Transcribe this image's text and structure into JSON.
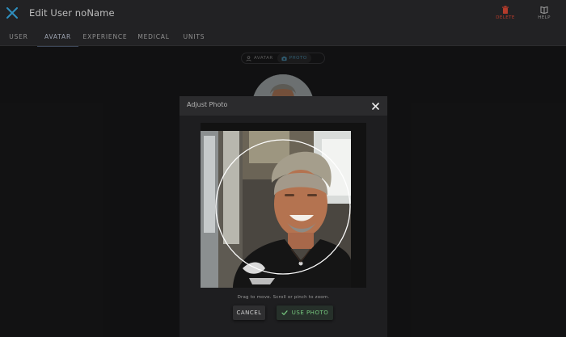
{
  "header": {
    "title": "Edit User noName",
    "actions": [
      {
        "label": "DELETE",
        "icon": "trash-icon"
      },
      {
        "label": "HELP",
        "icon": "book-icon"
      }
    ]
  },
  "tabs": [
    {
      "label": "USER",
      "active": false
    },
    {
      "label": "AVATAR",
      "active": true
    },
    {
      "label": "EXPERIENCE",
      "active": false
    },
    {
      "label": "MEDICAL",
      "active": false
    },
    {
      "label": "UNITS",
      "active": false
    }
  ],
  "avatar_mode": {
    "options": [
      {
        "label": "AVATAR",
        "icon": "user-icon",
        "selected": false
      },
      {
        "label": "PHOTO",
        "icon": "camera-icon",
        "selected": true
      }
    ]
  },
  "dialog": {
    "title": "Adjust Photo",
    "hint": "Drag to move. Scroll or pinch to zoom.",
    "cancel_label": "CANCEL",
    "use_label": "USE PHOTO"
  },
  "colors": {
    "accent_blue": "#4a8fb0",
    "delete_red": "#b53b2b",
    "confirm_green": "#76c77e"
  }
}
